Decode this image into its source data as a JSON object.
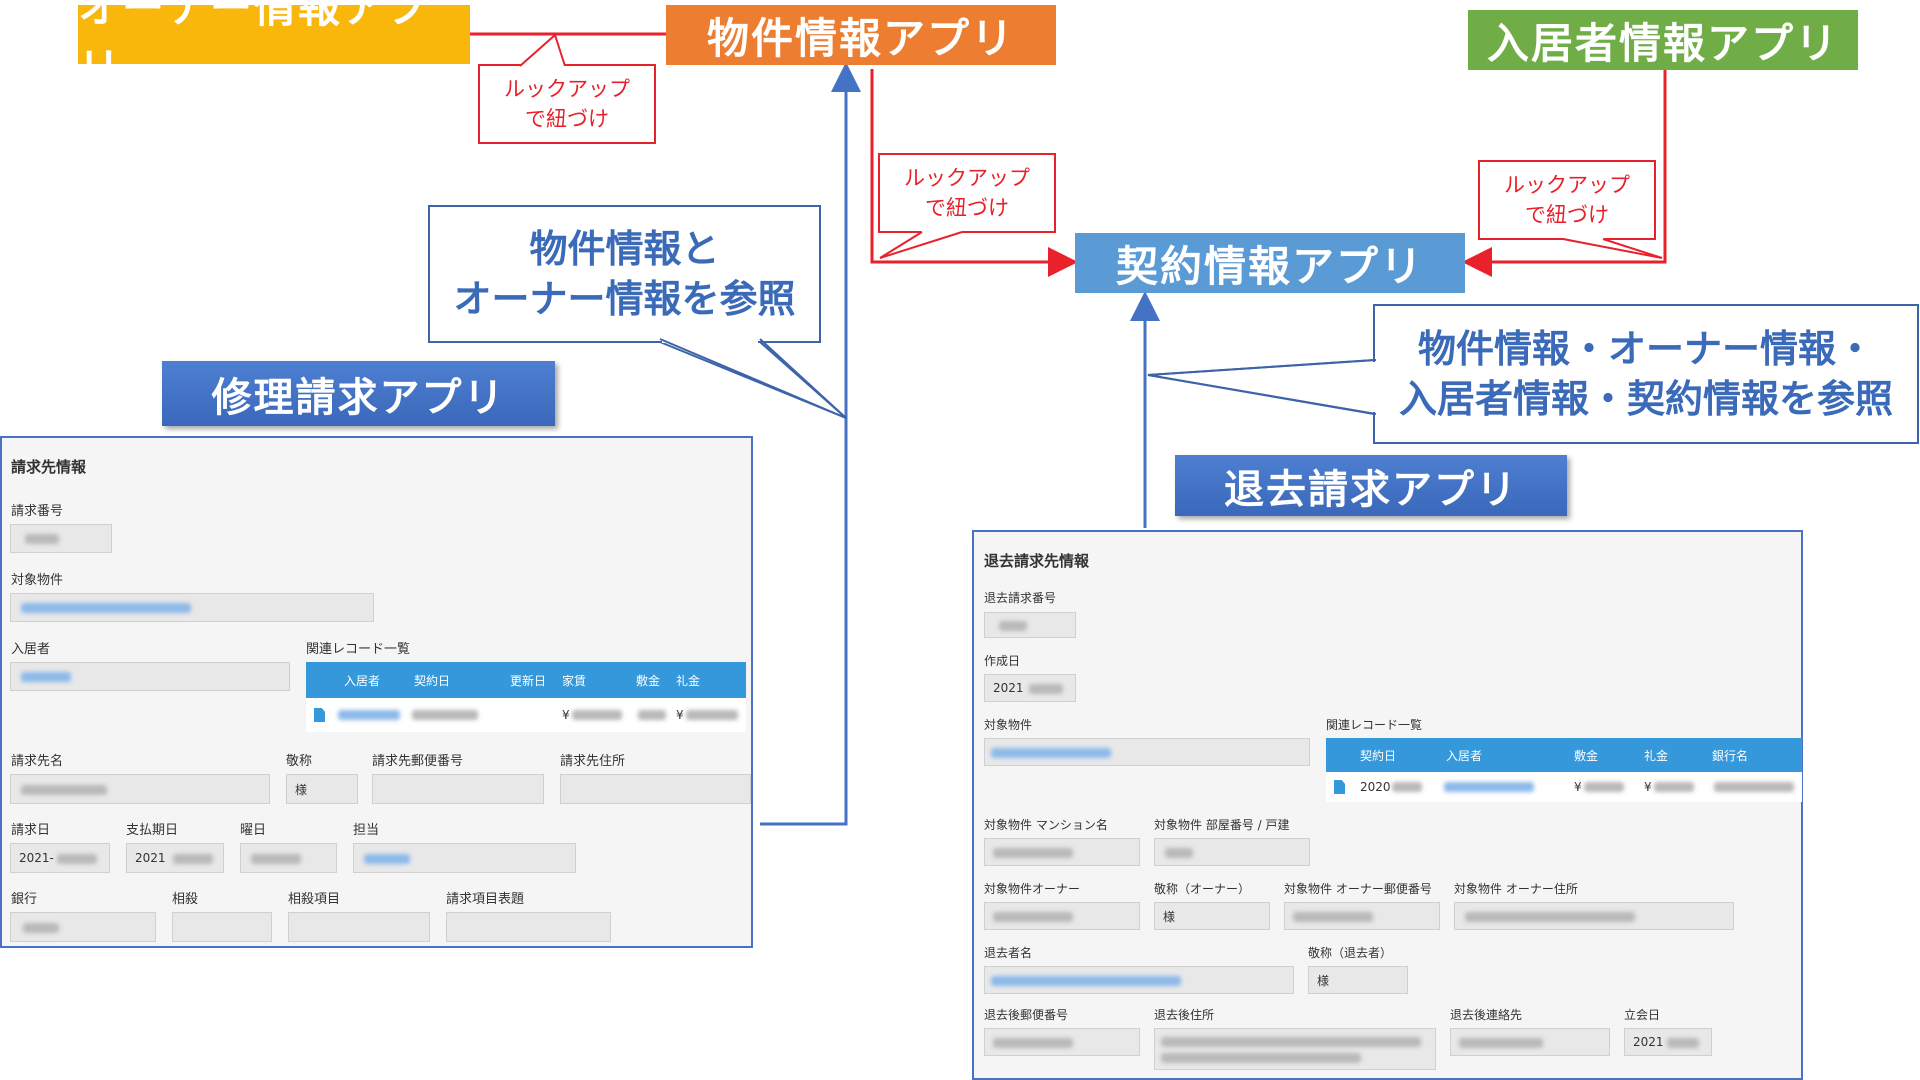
{
  "apps": {
    "owner": "オーナー情報アプリ",
    "property": "物件情報アプリ",
    "tenant": "入居者情報アプリ",
    "contract": "契約情報アプリ",
    "repair": "修理請求アプリ",
    "exit": "退去請求アプリ"
  },
  "callouts": {
    "lookup": [
      "ルックアップ",
      "で紐づけ"
    ],
    "repair_ref": [
      "物件情報と",
      "オーナー情報を参照"
    ],
    "exit_ref": [
      "物件情報・オーナー情報・",
      "入居者情報・契約情報を参照"
    ]
  },
  "colors": {
    "owner": "#F9B60B",
    "property": "#ED7D31",
    "tenant": "#70AD47",
    "contract": "#5B9BD5",
    "lookup_arrow": "#E8212B",
    "reference_arrow": "#4472C4"
  },
  "repair_form": {
    "title": "請求先情報",
    "request_no_label": "請求番号",
    "property_label": "対象物件",
    "tenant_label": "入居者",
    "related_label": "関連レコード一覧",
    "table_headers": [
      "入居者",
      "契約日",
      "更新日",
      "家賃",
      "敷金",
      "礼金"
    ],
    "row_yen1": "¥",
    "row_yen2": "¥",
    "billto_name_label": "請求先名",
    "honorific_label": "敬称",
    "honorific_value": "様",
    "billto_zip_label": "請求先郵便番号",
    "billto_addr_label": "請求先住所",
    "request_date_label": "請求日",
    "request_date_value": "2021-",
    "pay_date_label": "支払期日",
    "pay_date_value": "2021",
    "weekday_label": "曜日",
    "staff_label": "担当",
    "bank_label": "銀行",
    "offset_label": "相殺",
    "offset_item_label": "相殺項目",
    "item_heading_label": "請求項目表題"
  },
  "exit_form": {
    "title": "退去請求先情報",
    "exit_no_label": "退去請求番号",
    "created_label": "作成日",
    "created_value": "2021",
    "property_label": "対象物件",
    "related_label": "関連レコード一覧",
    "table_headers": [
      "契約日",
      "入居者",
      "敷金",
      "礼金",
      "銀行名"
    ],
    "row_date": "2020",
    "row_yen1": "¥",
    "row_yen2": "¥",
    "mansion_label": "対象物件 マンション名",
    "room_label": "対象物件 部屋番号 / 戸建",
    "owner_label": "対象物件オーナー",
    "owner_honorific_label": "敬称（オーナー）",
    "owner_honorific_value": "様",
    "owner_zip_label": "対象物件 オーナー郵便番号",
    "owner_addr_label": "対象物件 オーナー住所",
    "leaver_label": "退去者名",
    "leaver_honorific_label": "敬称（退去者）",
    "leaver_honorific_value": "様",
    "after_zip_label": "退去後郵便番号",
    "after_addr_label": "退去後住所",
    "after_contact_label": "退去後連絡先",
    "attend_date_label": "立会日",
    "attend_date_value": "2021"
  }
}
